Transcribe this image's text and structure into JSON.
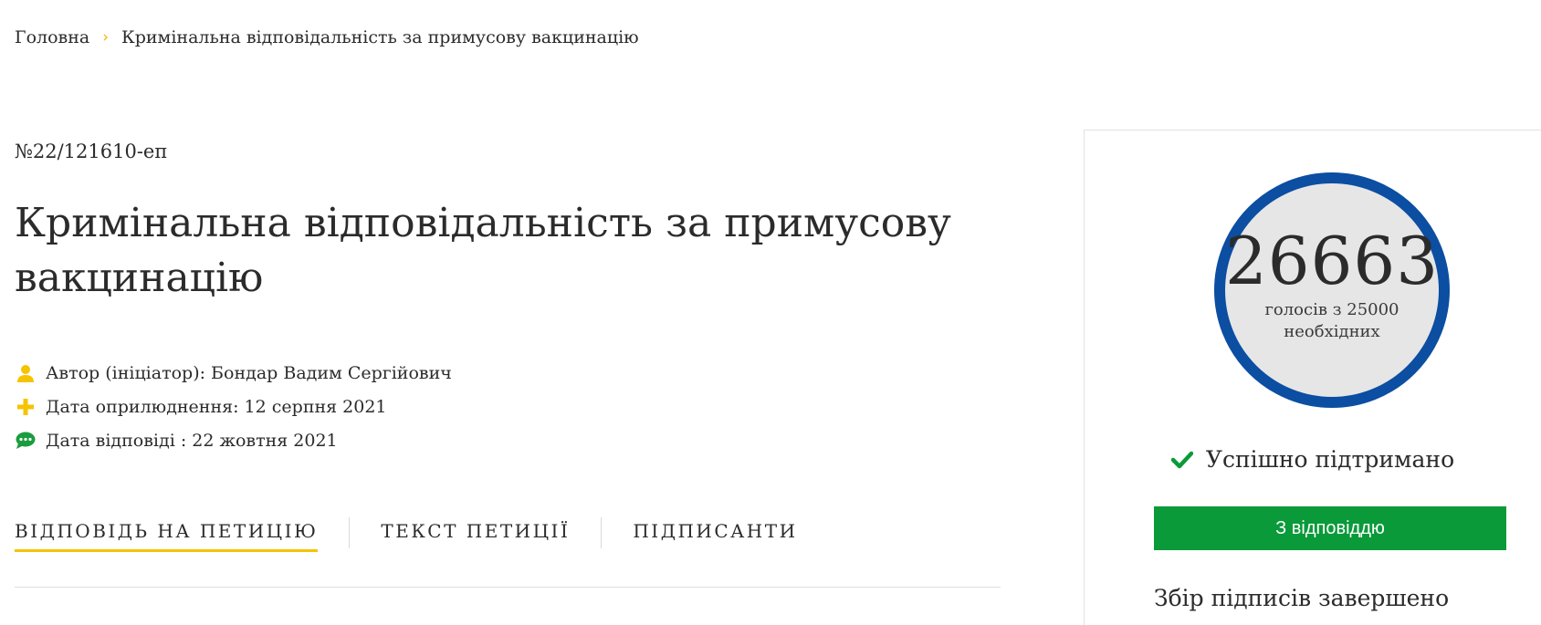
{
  "breadcrumb": {
    "home": "Головна",
    "current": "Кримінальна відповідальність за примусову вакцинацію"
  },
  "petition": {
    "number": "№22/121610-еп",
    "title": "Кримінальна відповідальність за примусову вакцинацію",
    "author": "Автор (ініціатор): Бондар Вадим Сергійович",
    "published": "Дата оприлюднення: 12 серпня 2021",
    "answered": "Дата відповіді : 22 жовтня 2021"
  },
  "tabs": [
    {
      "label": "ВІДПОВІДЬ НА ПЕТИЦІЮ",
      "active": true
    },
    {
      "label": "ТЕКСТ ПЕТИЦІЇ",
      "active": false
    },
    {
      "label": "ПІДПИСАНТИ",
      "active": false
    }
  ],
  "side": {
    "votes": "26663",
    "votes_caption_1": "голосів з 25000",
    "votes_caption_2": "необхідних",
    "status": "Успішно підтримано",
    "answer_button": "З відповіддю",
    "collection_status": "Збір підписів завершено"
  },
  "icons": {
    "author": "user-icon",
    "published": "plus-icon",
    "answered": "comment-icon",
    "status": "check-icon"
  },
  "colors": {
    "accent_yellow": "#f5c400",
    "counter_blue": "#0b4ea2",
    "success_green": "#0a9a3a",
    "comment_green": "#1b9c3f"
  }
}
